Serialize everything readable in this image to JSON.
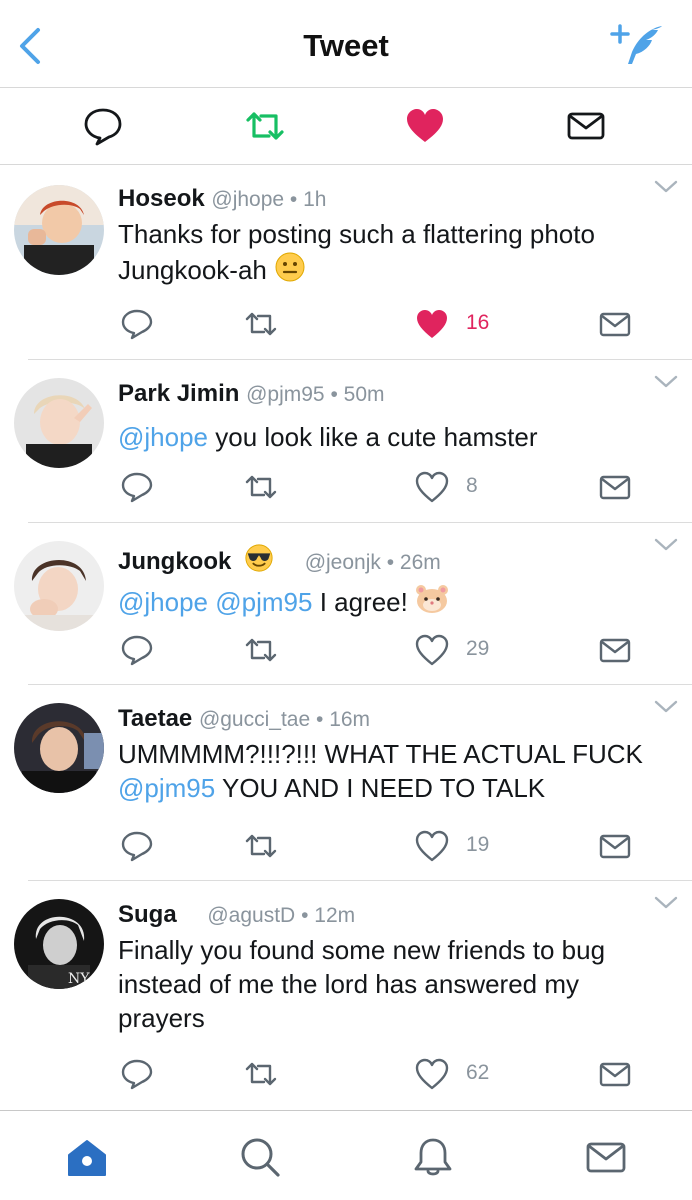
{
  "header": {
    "title": "Tweet"
  },
  "icons": {
    "back": "chevron-left-icon",
    "compose": "compose-tweet-icon",
    "reply": "reply-icon",
    "retweet": "retweet-icon",
    "like": "heart-icon",
    "dm": "envelope-icon",
    "home": "home-icon",
    "search": "search-icon",
    "notifications": "bell-icon",
    "messages": "envelope-icon"
  },
  "colors": {
    "accent": "#4fa3e8",
    "retweet": "#17bf63",
    "like": "#e0245e",
    "muted": "#8a949d"
  },
  "tweets": [
    {
      "name": "Hoseok",
      "handle": "@jhope",
      "time": "1h",
      "text_line1": "Thanks for posting such a flattering photo",
      "text_line2": "Jungkook-ah",
      "emoji": "neutral-face-emoji",
      "likes": "16",
      "liked": true
    },
    {
      "name": "Park Jimin",
      "handle": "@pjm95",
      "time": "50m",
      "mention1": "@jhope",
      "text": " you look like a cute hamster",
      "likes": "8"
    },
    {
      "name": "Jungkook",
      "name_emoji": "sunglasses-emoji",
      "handle": "@jeonjk",
      "time": "26m",
      "mention1": "@jhope",
      "mention2": "@pjm95",
      "text": " I agree! ",
      "emoji": "hamster-emoji",
      "likes": "29"
    },
    {
      "name": "Taetae",
      "handle": "@gucci_tae",
      "time": "16m",
      "text_line1": "UMMMMM?!!!?!!! WHAT THE ACTUAL FUCK",
      "mention1": "@pjm95",
      "text_line2": " YOU AND I NEED TO TALK",
      "likes": "19"
    },
    {
      "name": "Suga",
      "handle": "@agustD",
      "time": "12m",
      "text_line1": "Finally you found some new friends to bug",
      "text_line2": "instead of me the lord has answered my",
      "text_line3": "prayers",
      "likes": "62"
    }
  ],
  "separator": "•"
}
